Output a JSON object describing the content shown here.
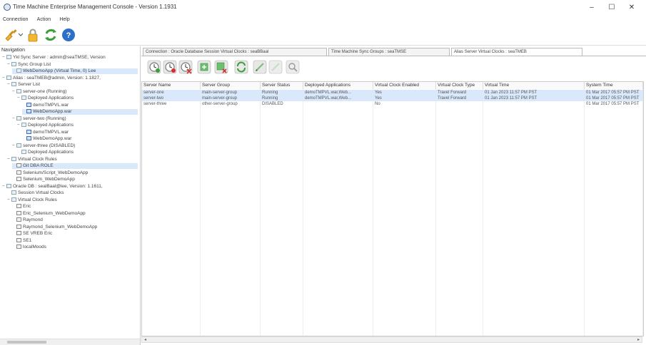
{
  "window": {
    "title": "Time Machine Enterprise Management Console - Version 1.1931",
    "minimize_label": "–",
    "maximize_label": "☐",
    "close_label": "✕"
  },
  "menu": [
    "Connection",
    "Action",
    "Help"
  ],
  "navigation": {
    "header": "Navigation",
    "tree": [
      {
        "indent": 0,
        "expander": "−",
        "icon": "server",
        "label": "Ykl Sync Server : admin@seaTMSE, Version"
      },
      {
        "indent": 1,
        "expander": "−",
        "icon": "folder",
        "label": "Sync Group List"
      },
      {
        "indent": 2,
        "expander": "",
        "icon": "group",
        "label": "WebDemoApp (Virtual Time, 0) Lee",
        "selected": true
      },
      {
        "indent": 0,
        "expander": "−",
        "icon": "server",
        "label": "Alias : seaTMEB@admin, Version: 1.1827,"
      },
      {
        "indent": 1,
        "expander": "−",
        "icon": "folder",
        "label": "Server List"
      },
      {
        "indent": 2,
        "expander": "−",
        "icon": "server",
        "label": "server-one (Running)"
      },
      {
        "indent": 3,
        "expander": "−",
        "icon": "folder",
        "label": "Deployed Applications"
      },
      {
        "indent": 4,
        "expander": "",
        "icon": "app",
        "label": "demoTMPVL.war"
      },
      {
        "indent": 4,
        "expander": "",
        "icon": "app",
        "label": "WebDemoApp.war",
        "selected": true
      },
      {
        "indent": 2,
        "expander": "−",
        "icon": "server",
        "label": "server-two (Running)"
      },
      {
        "indent": 3,
        "expander": "−",
        "icon": "folder",
        "label": "Deployed Applications"
      },
      {
        "indent": 4,
        "expander": "",
        "icon": "app",
        "label": "demoTMPVL.war"
      },
      {
        "indent": 4,
        "expander": "",
        "icon": "app",
        "label": "WebDemoApp.war"
      },
      {
        "indent": 2,
        "expander": "−",
        "icon": "server",
        "label": "server-three (DISABLED)"
      },
      {
        "indent": 3,
        "expander": "",
        "icon": "folder",
        "label": "Deployed Applications"
      },
      {
        "indent": 1,
        "expander": "−",
        "icon": "folder",
        "label": "Virtual Clock Rules"
      },
      {
        "indent": 2,
        "expander": "",
        "icon": "clock",
        "label": "Git DBA ROLE",
        "selected": true
      },
      {
        "indent": 2,
        "expander": "",
        "icon": "clock",
        "label": "Selenium/Script_WebDemoApp"
      },
      {
        "indent": 2,
        "expander": "",
        "icon": "clock",
        "label": "Selenium_WebDemoApp"
      },
      {
        "indent": 0,
        "expander": "−",
        "icon": "server",
        "label": "Oracle DB : sealBaal@lee, Version: 1.1611,"
      },
      {
        "indent": 1,
        "expander": "",
        "icon": "folder",
        "label": "Session Virtual Clocks"
      },
      {
        "indent": 1,
        "expander": "−",
        "icon": "folder",
        "label": "Virtual Clock Rules"
      },
      {
        "indent": 2,
        "expander": "",
        "icon": "clock",
        "label": "Eric"
      },
      {
        "indent": 2,
        "expander": "",
        "icon": "clock",
        "label": "Eric_Selenium_WebDemoApp"
      },
      {
        "indent": 2,
        "expander": "",
        "icon": "clock",
        "label": "Raymond"
      },
      {
        "indent": 2,
        "expander": "",
        "icon": "clock",
        "label": "Raymond_Selenium_WebDemoApp"
      },
      {
        "indent": 2,
        "expander": "",
        "icon": "clock",
        "label": "SE VREB Eric"
      },
      {
        "indent": 2,
        "expander": "",
        "icon": "clock",
        "label": "SE1"
      },
      {
        "indent": 2,
        "expander": "",
        "icon": "clock",
        "label": "localMoods"
      }
    ]
  },
  "tabs": [
    {
      "label": "Connection : Oracle Database Session Virtual Clocks : seaBBaal",
      "active": false
    },
    {
      "label": "Time Machine Sync Groups : seaTMSE",
      "active": false
    },
    {
      "label": "Alias Server Virtual Clocks : seaTMEB",
      "active": true
    }
  ],
  "content_toolbar": [
    "start-clock-icon",
    "stop-clock-icon",
    "reset-clock-icon",
    "add-rule-icon",
    "delete-rule-icon",
    "refresh-icon",
    "edit-icon",
    "edit-disabled-icon",
    "search-icon"
  ],
  "table": {
    "columns": [
      "Server Name",
      "Server Group",
      "Server Status",
      "Deployed Applications",
      "Virtual Clock Enabled",
      "Virtual Clock Type",
      "Virtual Time",
      "System Time"
    ],
    "rows": [
      {
        "cells": [
          "server-one",
          "main-server-group",
          "Running",
          "demoTMPVL.war,Web...",
          "Yes",
          "Travel Forward",
          "01 Jan 2023 11:57 PM PST",
          "01 Mar 2017 05:57 PM PST"
        ],
        "selected": true
      },
      {
        "cells": [
          "server-two",
          "main-server-group",
          "Running",
          "demoTMPVL.war,Web...",
          "Yes",
          "Travel Forward",
          "01 Jan 2023 11:57 PM PST",
          "01 Mar 2017 05:57 PM PST"
        ],
        "selected": true
      },
      {
        "cells": [
          "server-three",
          "other-server-group",
          "DISABLED",
          "",
          "No",
          "",
          "",
          "01 Mar 2017 05:57 PM PST"
        ],
        "selected": false
      }
    ]
  },
  "colors": {
    "selection": "#d9e8fb",
    "accent": "#2c6fc9"
  }
}
